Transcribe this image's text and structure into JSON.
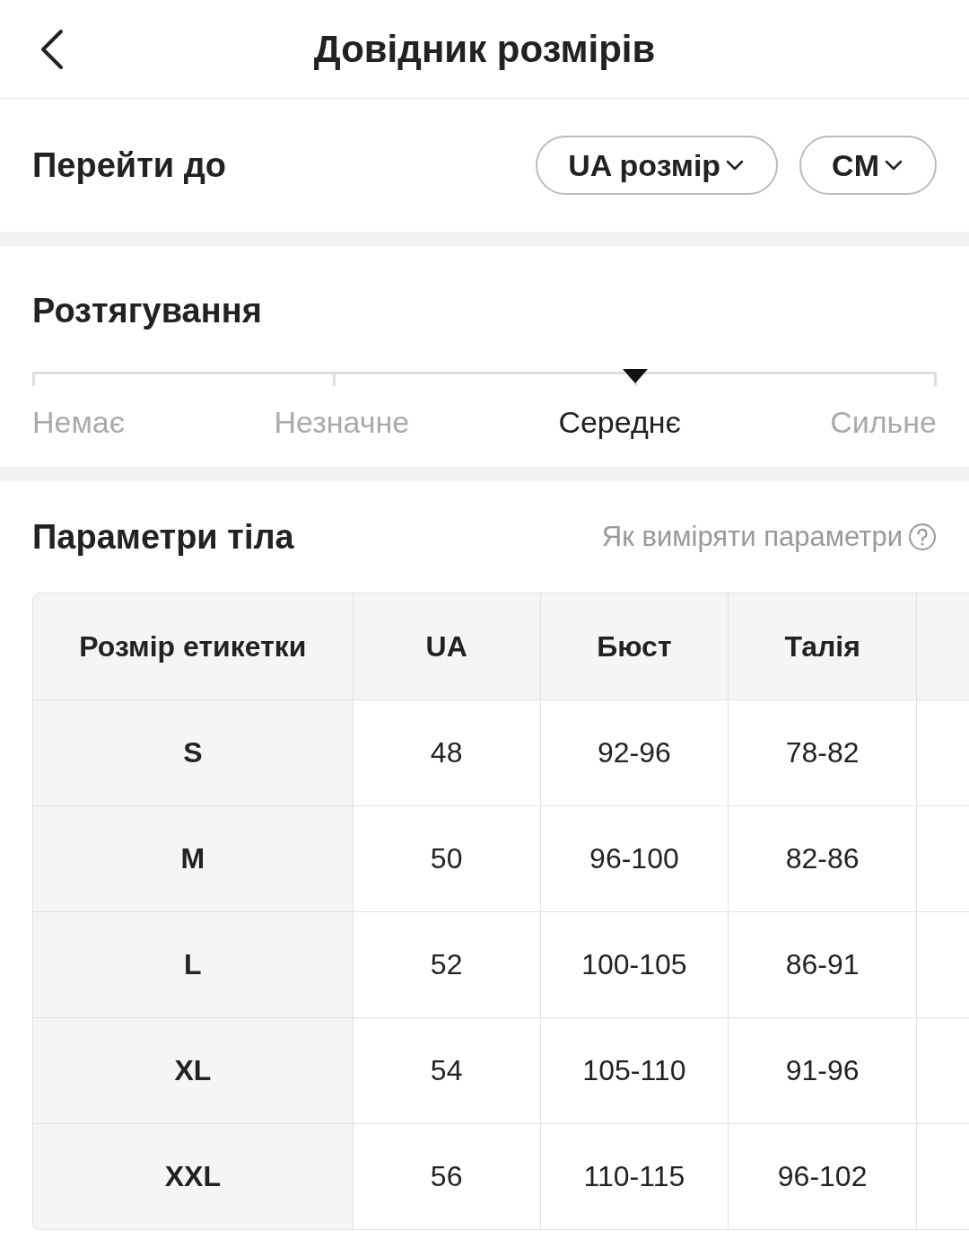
{
  "header": {
    "title": "Довідник розмірів"
  },
  "jump": {
    "label": "Перейти до",
    "dropdowns": [
      {
        "label": "UA розмір"
      },
      {
        "label": "CM"
      }
    ]
  },
  "stretch": {
    "title": "Розтягування",
    "levels": [
      {
        "label": "Немає",
        "selected": false
      },
      {
        "label": "Незначне",
        "selected": false
      },
      {
        "label": "Середнє",
        "selected": true
      },
      {
        "label": "Сильне",
        "selected": false
      }
    ]
  },
  "body": {
    "title": "Параметри тіла",
    "help_link": "Як виміряти параметри"
  },
  "table": {
    "columns": [
      "Розмір етикетки",
      "UA",
      "Бюст",
      "Талія"
    ],
    "rows": [
      [
        "S",
        "48",
        "92-96",
        "78-82"
      ],
      [
        "M",
        "50",
        "96-100",
        "82-86"
      ],
      [
        "L",
        "52",
        "100-105",
        "86-91"
      ],
      [
        "XL",
        "54",
        "105-110",
        "91-96"
      ],
      [
        "XXL",
        "56",
        "110-115",
        "96-102"
      ]
    ]
  }
}
